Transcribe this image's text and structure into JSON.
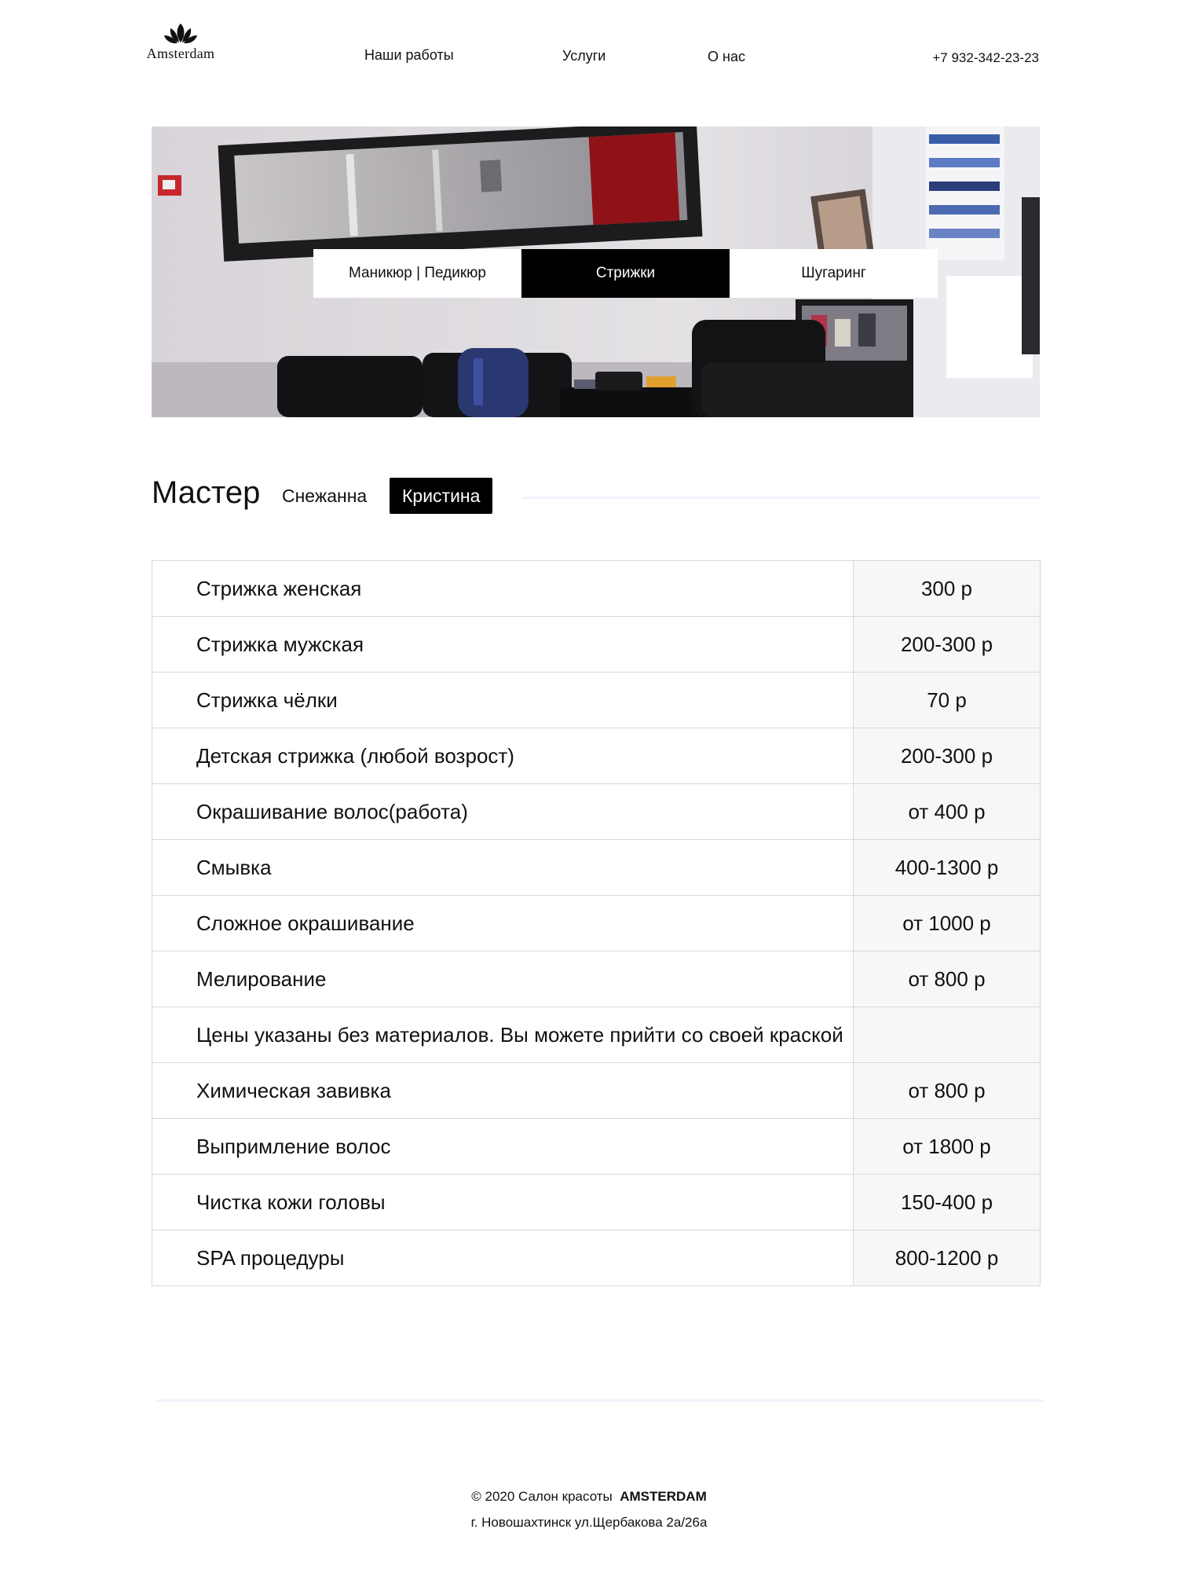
{
  "header": {
    "logo_text": "Amsterdam",
    "nav": [
      "Наши работы",
      "Услуги",
      "О нас"
    ],
    "phone": "+7 932-342-23-23"
  },
  "categories": {
    "items": [
      "Маникюр | Педикюр",
      "Стрижки",
      "Шугаринг"
    ],
    "active": "Стрижки"
  },
  "master": {
    "title": "Мастер",
    "options": [
      "Снежанна",
      "Кристина"
    ],
    "active": "Кристина"
  },
  "prices": [
    {
      "name": "Стрижка женская",
      "price": "300 р"
    },
    {
      "name": "Стрижка мужская",
      "price": "200-300 р"
    },
    {
      "name": "Стрижка чёлки",
      "price": "70 р"
    },
    {
      "name": "Детская стрижка (любой возрост)",
      "price": "200-300 р"
    },
    {
      "name": "Окрашивание волос(работа)",
      "price": "от 400 р"
    },
    {
      "name": "Смывка",
      "price": "400-1300 р"
    },
    {
      "name": "Сложное окрашивание",
      "price": "от 1000 р"
    },
    {
      "name": "Мелирование",
      "price": "от 800 р"
    },
    {
      "name": "Цены указаны без материалов. Вы можете прийти со своей краской",
      "price": ""
    },
    {
      "name": "Химическая завивка",
      "price": "от 800 р"
    },
    {
      "name": "Выпримление волос",
      "price": "от 1800 р"
    },
    {
      "name": "Чистка кожи головы",
      "price": "150-400 р"
    },
    {
      "name": "SPA процедуры",
      "price": "800-1200 р"
    }
  ],
  "footer": {
    "copyright": "© 2020 Салон красоты",
    "brand": "AMSTERDAM",
    "address": "г. Новошахтинск  ул.Щербакова 2а/26а"
  },
  "colors": {
    "accent": "#000000",
    "divider": "#eef4fb",
    "price_bg": "#f7f7f7"
  }
}
